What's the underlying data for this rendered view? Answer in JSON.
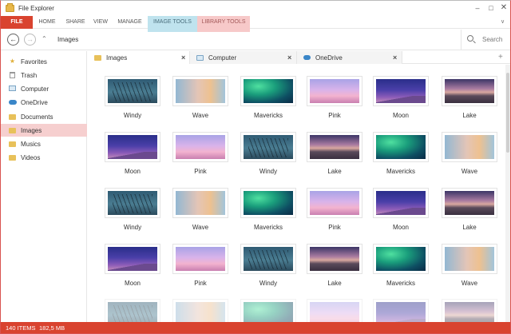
{
  "window": {
    "title": "File Explorer"
  },
  "ribbon": {
    "tabs": [
      "FILE",
      "HOME",
      "SHARE",
      "VIEW",
      "MANAGE",
      "IMAGE TOOLS",
      "LIBRARY TOOLS"
    ]
  },
  "address": {
    "path": "Images",
    "search_placeholder": "Search"
  },
  "sidebar": {
    "items": [
      {
        "label": "Favorites",
        "icon": "star-icon"
      },
      {
        "label": "Trash",
        "icon": "trash-icon"
      },
      {
        "label": "Computer",
        "icon": "computer-icon"
      },
      {
        "label": "OneDrive",
        "icon": "cloud-icon"
      },
      {
        "label": "Documents",
        "icon": "folder-icon"
      },
      {
        "label": "Images",
        "icon": "folder-icon",
        "active": true
      },
      {
        "label": "Musics",
        "icon": "folder-icon"
      },
      {
        "label": "Videos",
        "icon": "folder-icon"
      }
    ]
  },
  "tabs": [
    {
      "label": "Images",
      "active": true
    },
    {
      "label": "Computer",
      "active": false
    },
    {
      "label": "OneDrive",
      "active": false
    }
  ],
  "grid": {
    "rows": [
      [
        "Windy",
        "Wave",
        "Mavericks",
        "Pink",
        "Moon",
        "Lake"
      ],
      [
        "Moon",
        "Pink",
        "Windy",
        "Lake",
        "Mavericks",
        "Wave"
      ],
      [
        "Windy",
        "Wave",
        "Mavericks",
        "Pink",
        "Moon",
        "Lake"
      ],
      [
        "Moon",
        "Pink",
        "Windy",
        "Lake",
        "Mavericks",
        "Wave"
      ],
      [
        "",
        "",
        "",
        "",
        "",
        ""
      ]
    ]
  },
  "status": {
    "items": "140 ITEMS",
    "size": "182,5 MB"
  },
  "colors": {
    "accent": "#d9432f",
    "image_tools": "#bfe3ee",
    "library_tools": "#f7c9c9",
    "active_item": "#f6cfcf"
  }
}
